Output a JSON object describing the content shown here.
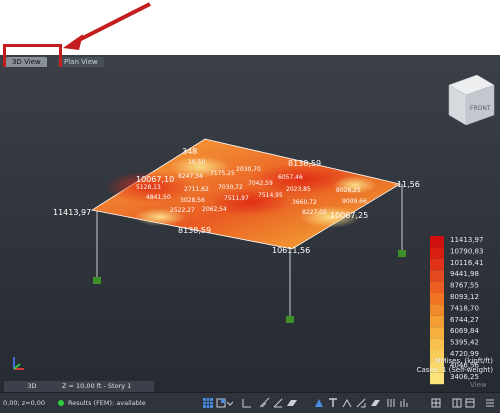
{
  "tabs": [
    {
      "label": "3D View",
      "active": true
    },
    {
      "label": "Plan View",
      "active": false
    }
  ],
  "view_cube": {
    "face_label": "FRONT"
  },
  "legend": {
    "values": [
      "11413,97",
      "10790,83",
      "10116,41",
      "9441,98",
      "8767,55",
      "8093,12",
      "7418,70",
      "6744,27",
      "6069,84",
      "5395,42",
      "4720,99",
      "4046,56",
      "3406,25"
    ],
    "colors": [
      "#d01010",
      "#da1e10",
      "#e0321a",
      "#e54a1e",
      "#eb6020",
      "#ef7424",
      "#f28a2c",
      "#f49e34",
      "#f6b040",
      "#f8c04c",
      "#f9cc5a",
      "#fbd86a",
      "#fce27a"
    ],
    "title": "MMises, (kipft/ft)",
    "cases": "Cases: 1 (Self-weight)"
  },
  "edge_labels": [
    "348",
    "8138,59",
    "10067,10",
    "11413,97",
    "-11,56",
    "10067,25",
    "8138,59",
    "10611,56"
  ],
  "contour_labels": [
    "10,50",
    "8247,34",
    "7175,25",
    "2030,70",
    "6057,46",
    "5128,13",
    "2711,62",
    "7030,72",
    "7042,59",
    "2023,85",
    "4841,50",
    "3028,56",
    "7511,97",
    "7514,95",
    "8026,25",
    "3660,72",
    "2522,27",
    "2062,54",
    "8227,02",
    "9009,66"
  ],
  "view_tabs": [
    "3D",
    "Z = 10,00 ft - Story 1"
  ],
  "status": {
    "coords": "0,00; z=0,00",
    "results": "Results (FEM): available"
  },
  "view_label": "View",
  "colors": {
    "annotation": "#c41d1d",
    "status_dot": "#2ecc40",
    "support": "#3f8f2a"
  }
}
